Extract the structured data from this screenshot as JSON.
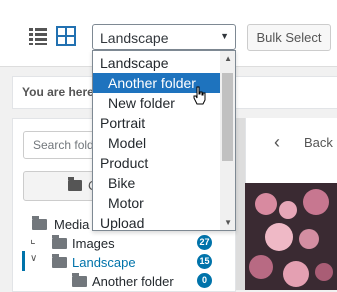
{
  "toolbar": {
    "list_view_icon": "list-view-icon",
    "grid_view_icon": "grid-view-icon",
    "folder_select": {
      "selected": "Landscape"
    },
    "bulk_select_label": "Bulk Select"
  },
  "notice": {
    "text": "You are here"
  },
  "sidebar": {
    "search_placeholder": "Search fold",
    "new_folder_label": "C",
    "tree": [
      {
        "label": "Media",
        "badge": ""
      },
      {
        "label": "Images",
        "badge": "27"
      },
      {
        "label": "Landscape",
        "badge": "15"
      },
      {
        "label": "Another folder",
        "badge": "0"
      }
    ]
  },
  "details": {
    "back_label": "Back"
  },
  "dropdown": {
    "options": [
      {
        "label": "Landscape",
        "indent": false
      },
      {
        "label": "Another folder",
        "indent": true,
        "highlighted": true
      },
      {
        "label": "New folder",
        "indent": true
      },
      {
        "label": "Portrait",
        "indent": false
      },
      {
        "label": "Model",
        "indent": true
      },
      {
        "label": "Product",
        "indent": false
      },
      {
        "label": "Bike",
        "indent": true
      },
      {
        "label": "Motor",
        "indent": true
      },
      {
        "label": "Upload",
        "indent": false
      }
    ]
  },
  "colors": {
    "accent": "#0073aa",
    "highlight": "#1e73be",
    "grid_icon": "#2271b1"
  }
}
